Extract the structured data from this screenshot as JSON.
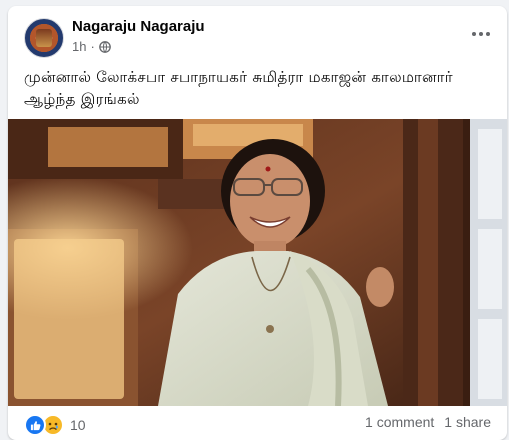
{
  "post": {
    "author": "Nagaraju Nagaraju",
    "time": "1h",
    "separator": "·",
    "text": "முன்னால் லோக்சபா சபாநாயகர் சுமித்ரா மகாஜன் காலமானார் ஆழ்ந்த இரங்கல்",
    "privacy_icon": "globe-icon",
    "menu_icon": "more-options-icon"
  },
  "footer": {
    "reaction_icons": [
      "like-icon",
      "sad-icon"
    ],
    "reaction_count": "10",
    "comments": "1 comment",
    "shares": "1 share"
  },
  "colors": {
    "facebook_blue": "#1877f2",
    "sad_yellow": "#f7b928",
    "meta_gray": "#65676b",
    "page_bg": "#f0f2f5"
  }
}
